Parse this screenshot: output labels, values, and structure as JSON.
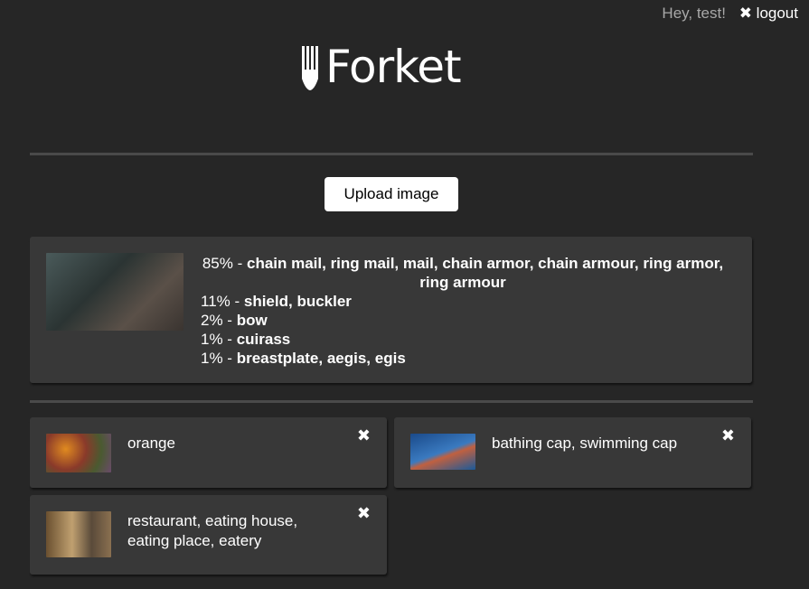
{
  "header": {
    "greeting": "Hey, test!",
    "logout_label": "✖ logout",
    "logo_text": "Forket"
  },
  "upload_label": "Upload image",
  "result": {
    "predictions": [
      {
        "percent": "85% - ",
        "label": "chain mail, ring mail, mail, chain armor, chain armour, ring armor, ring armour"
      },
      {
        "percent": "11% - ",
        "label": "shield, buckler"
      },
      {
        "percent": "2% - ",
        "label": "bow"
      },
      {
        "percent": "1% - ",
        "label": "cuirass"
      },
      {
        "percent": "1% - ",
        "label": "breastplate, aegis, egis"
      }
    ]
  },
  "history": [
    {
      "label": "orange",
      "close": "✖"
    },
    {
      "label": "bathing cap, swimming cap",
      "close": "✖"
    },
    {
      "label": "restaurant, eating house, eating place, eatery",
      "close": "✖"
    }
  ]
}
